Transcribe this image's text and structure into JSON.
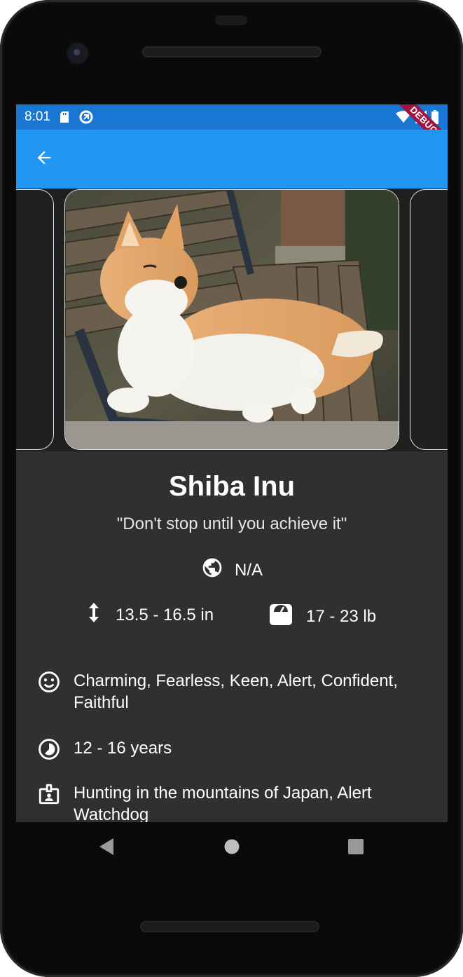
{
  "status_bar": {
    "time": "8:01",
    "icons": [
      "sd-card-icon",
      "data-saver-icon",
      "wifi-icon",
      "signal-icon",
      "battery-icon"
    ],
    "debug_banner": "DEBUG"
  },
  "app_bar": {
    "back_icon": "arrow-back-icon",
    "color": "#2196f3"
  },
  "carousel": {
    "images": [
      "Shiba Inu dog lying on a wooden park bench"
    ],
    "current_index": 1
  },
  "breed": {
    "name": "Shiba Inu",
    "motto": "\"Don't stop until you achieve it\"",
    "origin": "N/A",
    "height": "13.5 - 16.5 in",
    "weight": "17 - 23 lb",
    "temperament": "Charming, Fearless, Keen, Alert, Confident, Faithful",
    "life_span": "12 - 16 years",
    "bred_for": "Hunting in the mountains of Japan, Alert Watchdog"
  },
  "icons": {
    "origin": "globe-icon",
    "height": "height-arrows-icon",
    "weight": "scale-icon",
    "temperament": "smiley-face-icon",
    "life_span": "timelapse-icon",
    "bred_for": "badge-icon"
  },
  "nav_bar": {
    "buttons": [
      "back-triangle-icon",
      "home-circle-icon",
      "recents-square-icon"
    ]
  }
}
